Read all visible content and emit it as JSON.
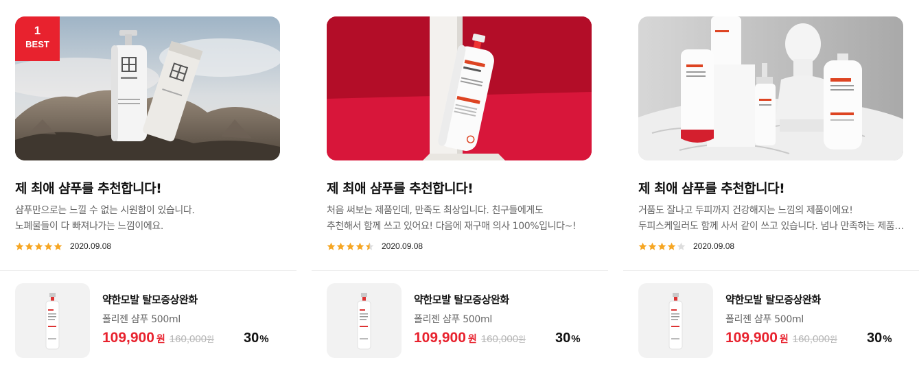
{
  "colors": {
    "accent": "#e8222e",
    "star": "#f6a623",
    "star_empty": "#dddddd"
  },
  "reviews": [
    {
      "best_badge": {
        "number": "1",
        "label": "BEST"
      },
      "image_alt": "ONNE body balm bottles on rocks",
      "title": "제 최애 샴푸를 추천합니다!",
      "body": [
        "샴푸만으로는 느낄 수 없는 시원함이 있습니다.",
        "노폐물들이 다 빠져나가는 느낌이에요."
      ],
      "rating": 5,
      "date": "2020.09.08",
      "product": {
        "name": "약한모발 탈모증상완화",
        "sub": "폴리젠 샴푸 500ml",
        "price": "109,900",
        "price_unit": "원",
        "original_price": "160,000",
        "original_unit": "원",
        "discount": "30",
        "discount_unit": "%"
      }
    },
    {
      "image_alt": "Folligen shampoo bottle on red background",
      "title": "제 최애 샴푸를 추천합니다!",
      "body": [
        "처음 써보는 제품인데, 만족도 최상입니다. 친구들에게도",
        "추천해서 함께 쓰고 있어요! 다음에 재구매 의사 100%입니다~!"
      ],
      "rating": 4.5,
      "date": "2020.09.08",
      "product": {
        "name": "약한모발 탈모증상완화",
        "sub": "폴리젠 샴푸 500ml",
        "price": "109,900",
        "price_unit": "원",
        "original_price": "160,000",
        "original_unit": "원",
        "discount": "30",
        "discount_unit": "%"
      }
    },
    {
      "image_alt": "Folligen product line on marble table",
      "title": "제 최애 샴푸를 추천합니다!",
      "body": [
        "거품도 잘나고 두피까지 건강해지는 느낌의 제품이에요!",
        "두피스케일러도 함께 사서 같이 쓰고 있습니다. 넘나 만족하는 제품입니다."
      ],
      "rating": 4,
      "date": "2020.09.08",
      "product": {
        "name": "약한모발 탈모증상완화",
        "sub": "폴리젠 샴푸 500ml",
        "price": "109,900",
        "price_unit": "원",
        "original_price": "160,000",
        "original_unit": "원",
        "discount": "30",
        "discount_unit": "%"
      }
    }
  ]
}
